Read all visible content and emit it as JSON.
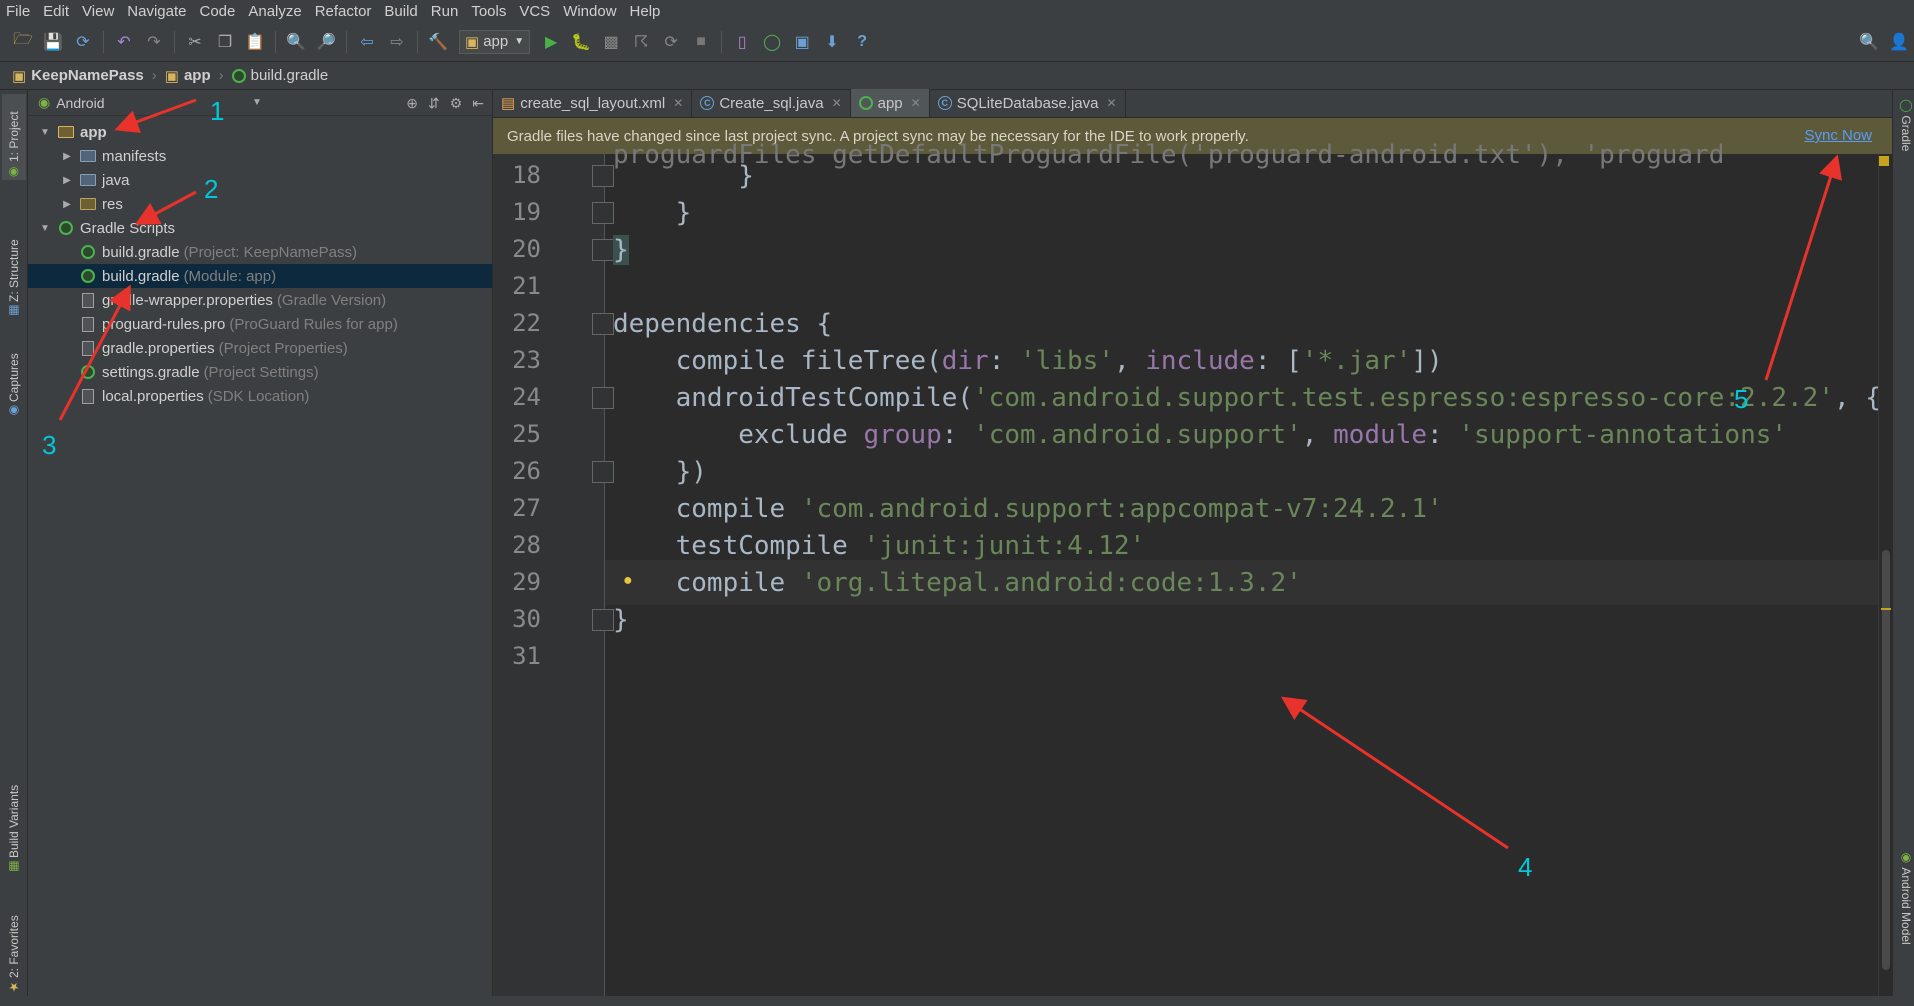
{
  "menu": [
    "File",
    "Edit",
    "View",
    "Navigate",
    "Code",
    "Analyze",
    "Refactor",
    "Build",
    "Run",
    "Tools",
    "VCS",
    "Window",
    "Help"
  ],
  "toolbar": {
    "run_config": "app"
  },
  "breadcrumb": [
    "KeepNamePass",
    "app",
    "build.gradle"
  ],
  "left_strip": {
    "project_tab": "1: Project",
    "structure_tab": "Z: Structure",
    "captures_tab": "Captures",
    "build_variants_tab": "Build Variants",
    "favorites_tab": "2: Favorites"
  },
  "right_strip": {
    "gradle_tab": "Gradle",
    "android_model_tab": "Android Model"
  },
  "project": {
    "view_mode": "Android",
    "tree": [
      {
        "label": "app",
        "hint": "",
        "indent": 0,
        "expanded": "open",
        "icon": "module-folder-icon",
        "bold": true
      },
      {
        "label": "manifests",
        "hint": "",
        "indent": 1,
        "expanded": "closed",
        "icon": "folder-icon"
      },
      {
        "label": "java",
        "hint": "",
        "indent": 1,
        "expanded": "closed",
        "icon": "folder-icon"
      },
      {
        "label": "res",
        "hint": "",
        "indent": 1,
        "expanded": "closed",
        "icon": "res-folder-icon"
      },
      {
        "label": "Gradle Scripts",
        "hint": "",
        "indent": 0,
        "expanded": "open",
        "icon": "gradle-icon"
      },
      {
        "label": "build.gradle",
        "hint": "(Project: KeepNamePass)",
        "indent": 1,
        "expanded": "none",
        "icon": "gradle-icon"
      },
      {
        "label": "build.gradle",
        "hint": "(Module: app)",
        "indent": 1,
        "expanded": "none",
        "icon": "gradle-icon",
        "selected": true
      },
      {
        "label": "gradle-wrapper.properties",
        "hint": "(Gradle Version)",
        "indent": 1,
        "expanded": "none",
        "icon": "properties-file-icon"
      },
      {
        "label": "proguard-rules.pro",
        "hint": "(ProGuard Rules for app)",
        "indent": 1,
        "expanded": "none",
        "icon": "text-file-icon"
      },
      {
        "label": "gradle.properties",
        "hint": "(Project Properties)",
        "indent": 1,
        "expanded": "none",
        "icon": "properties-file-icon"
      },
      {
        "label": "settings.gradle",
        "hint": "(Project Settings)",
        "indent": 1,
        "expanded": "none",
        "icon": "gradle-icon"
      },
      {
        "label": "local.properties",
        "hint": "(SDK Location)",
        "indent": 1,
        "expanded": "none",
        "icon": "properties-file-icon"
      }
    ]
  },
  "editor_tabs": [
    {
      "label": "create_sql_layout.xml",
      "icon": "xml-file-icon",
      "active": false
    },
    {
      "label": "Create_sql.java",
      "icon": "java-class-icon",
      "active": false
    },
    {
      "label": "app",
      "icon": "gradle-icon",
      "active": true
    },
    {
      "label": "SQLiteDatabase.java",
      "icon": "java-class-icon",
      "active": false
    }
  ],
  "notification": {
    "message": "Gradle files have changed since last project sync. A project sync may be necessary for the IDE to work properly.",
    "action": "Sync Now"
  },
  "code": {
    "partial_line_text": "proguardFiles getDefaultProguardFile('proguard-android.txt'), 'proguard",
    "lines": [
      {
        "num": "18",
        "text": "        }"
      },
      {
        "num": "19",
        "text": "    }"
      },
      {
        "num": "20",
        "text": "}"
      },
      {
        "num": "21",
        "text": ""
      },
      {
        "num": "22",
        "text": "dependencies {"
      },
      {
        "num": "23",
        "text": "    compile fileTree(dir: 'libs', include: ['*.jar'])"
      },
      {
        "num": "24",
        "text": "    androidTestCompile('com.android.support.test.espresso:espresso-core:2.2.2', {"
      },
      {
        "num": "25",
        "text": "        exclude group: 'com.android.support', module: 'support-annotations'"
      },
      {
        "num": "26",
        "text": "    })"
      },
      {
        "num": "27",
        "text": "    compile 'com.android.support:appcompat-v7:24.2.1'"
      },
      {
        "num": "28",
        "text": "    testCompile 'junit:junit:4.12'"
      },
      {
        "num": "29",
        "text": "    compile 'org.litepal.android:code:1.3.2'"
      },
      {
        "num": "30",
        "text": "}"
      },
      {
        "num": "31",
        "text": ""
      }
    ]
  },
  "annotations": [
    "1",
    "2",
    "3",
    "4",
    "5"
  ],
  "colors": {
    "annotation_arrow": "#e8322c",
    "annotation_number": "#00c8d8",
    "string": "#6a8759",
    "param": "#9876aa",
    "notify_bg": "#5c5a3a",
    "link": "#589df6"
  }
}
